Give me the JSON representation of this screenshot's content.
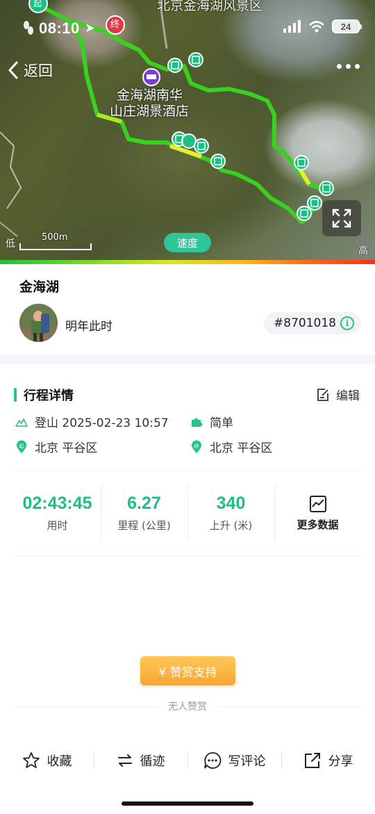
{
  "status_bar": {
    "time": "08:10",
    "battery": "24"
  },
  "map": {
    "back_label": "返回",
    "poi_name_line1": "金海湖南华",
    "poi_name_line2": "山庄湖景酒店",
    "area_label": "北京金海湖风景区",
    "start_marker": "起",
    "end_marker": "终",
    "scale_label": "500m",
    "low_label": "低",
    "high_label": "高",
    "speed_button": "速度"
  },
  "track": {
    "title": "金海湖",
    "user_name": "明年此时",
    "track_id": "#8701018"
  },
  "details": {
    "heading": "行程详情",
    "edit_label": "编辑",
    "activity": "登山 2025-02-23 10:57",
    "difficulty": "简单",
    "start_place": "北京 平谷区",
    "end_place": "北京 平谷区",
    "start_badge": "起",
    "end_badge": "终"
  },
  "stats": {
    "duration_value": "02:43:45",
    "duration_label": "用时",
    "distance_value": "6.27",
    "distance_label": "里程 (公里)",
    "ascent_value": "340",
    "ascent_label": "上升 (米)",
    "more_label": "更多数据"
  },
  "reward": {
    "button_label": "¥ 赞赏支持",
    "empty_text": "无人赞赏"
  },
  "actions": {
    "favorite": "收藏",
    "follow_track": "循迹",
    "comment": "写评论",
    "share": "分享"
  },
  "colors": {
    "accent": "#27c28a",
    "route_green": "#39d11f",
    "route_yellow": "#e8ee2a",
    "reward_orange": "#f6a630",
    "end_marker_red": "#e03a45"
  }
}
